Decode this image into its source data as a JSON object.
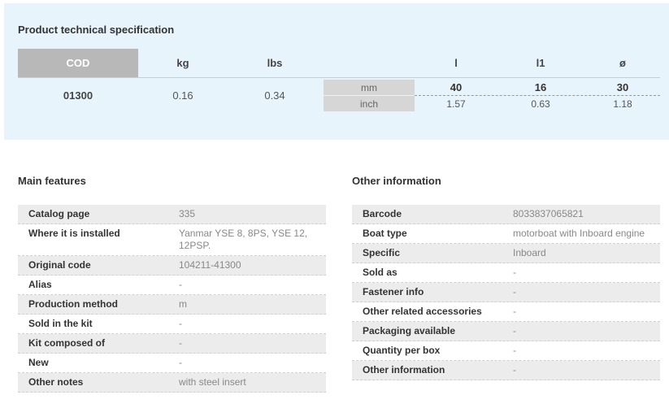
{
  "spec": {
    "title": "Product technical specification",
    "headers": {
      "cod": "COD",
      "kg": "kg",
      "lbs": "lbs",
      "l": "l",
      "l1": "l1",
      "diameter": "ø"
    },
    "row": {
      "cod": "01300",
      "kg": "0.16",
      "lbs": "0.34"
    },
    "units": {
      "mm": "mm",
      "inch": "inch"
    },
    "mm_values": {
      "l": "40",
      "l1": "16",
      "diameter": "30"
    },
    "inch_values": {
      "l": "1.57",
      "l1": "0.63",
      "diameter": "1.18"
    }
  },
  "main_features": {
    "title": "Main features",
    "rows": [
      {
        "label": "Catalog page",
        "value": "335"
      },
      {
        "label": "Where it is installed",
        "value": "Yanmar YSE 8, 8PS, YSE 12, 12PSP."
      },
      {
        "label": "Original code",
        "value": "104211-41300"
      },
      {
        "label": "Alias",
        "value": "-"
      },
      {
        "label": "Production method",
        "value": "m"
      },
      {
        "label": "Sold in the kit",
        "value": "-"
      },
      {
        "label": "Kit composed of",
        "value": "-"
      },
      {
        "label": "New",
        "value": "-"
      },
      {
        "label": "Other notes",
        "value": "with steel insert"
      }
    ]
  },
  "other_info": {
    "title": "Other information",
    "rows": [
      {
        "label": "Barcode",
        "value": "8033837065821"
      },
      {
        "label": "Boat type",
        "value": "motorboat with Inboard engine"
      },
      {
        "label": "Specific",
        "value": "Inboard"
      },
      {
        "label": "Sold as",
        "value": "-"
      },
      {
        "label": "Fastener info",
        "value": "-"
      },
      {
        "label": "Other related accessories",
        "value": "-"
      },
      {
        "label": "Packaging available",
        "value": "-"
      },
      {
        "label": "Quantity per box",
        "value": "-"
      },
      {
        "label": "Other information",
        "value": "-"
      }
    ]
  }
}
